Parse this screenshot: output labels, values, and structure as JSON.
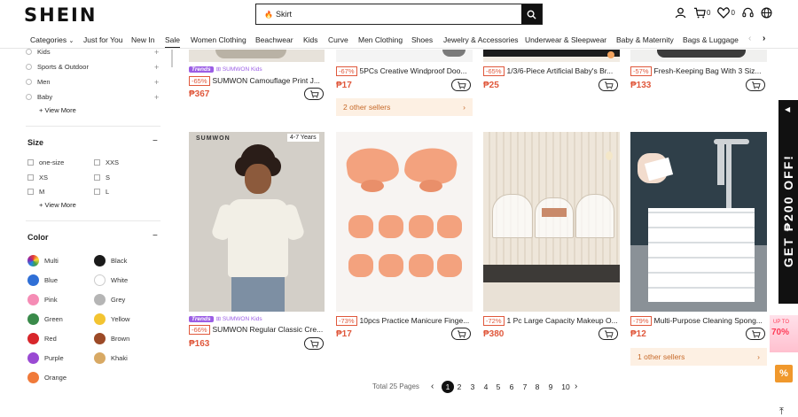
{
  "header": {
    "logo": "SHEIN",
    "search_value": "Skirt",
    "cart_count": "0",
    "wishlist_count": "0"
  },
  "nav": {
    "categories": [
      "Categories",
      "Just for You",
      "New In",
      "Sale",
      "Women Clothing",
      "Beachwear",
      "Kids",
      "Curve",
      "Men Clothing",
      "Shoes",
      "Jewelry & Accessories",
      "Underwear & Sleepwear",
      "Baby & Maternity",
      "Bags & Luggage"
    ]
  },
  "sidebar": {
    "categories": [
      "Kids",
      "Sports & Outdoor",
      "Men",
      "Baby"
    ],
    "view_more": "View More",
    "size_title": "Size",
    "sizes": [
      "one-size",
      "XXS",
      "XS",
      "S",
      "M",
      "L"
    ],
    "color_title": "Color",
    "colors": [
      {
        "label": "Multi",
        "hex": "multi"
      },
      {
        "label": "Black",
        "hex": "#1a1a1a"
      },
      {
        "label": "Blue",
        "hex": "#2f6fd6"
      },
      {
        "label": "White",
        "hex": "#ffffff"
      },
      {
        "label": "Pink",
        "hex": "#f58cb5"
      },
      {
        "label": "Grey",
        "hex": "#b5b5b5"
      },
      {
        "label": "Green",
        "hex": "#3a8a4a"
      },
      {
        "label": "Yellow",
        "hex": "#f3c431"
      },
      {
        "label": "Red",
        "hex": "#d8262b"
      },
      {
        "label": "Brown",
        "hex": "#9c4a27"
      },
      {
        "label": "Purple",
        "hex": "#9a4ad3"
      },
      {
        "label": "Khaki",
        "hex": "#d8a964"
      },
      {
        "label": "Orange",
        "hex": "#f07a3a"
      }
    ]
  },
  "products_top": [
    {
      "trend": "Trends",
      "brand": "SUMWON Kids",
      "discount": "-65%",
      "title": "SUMWON Camouflage Print J...",
      "price": "₱367"
    },
    {
      "discount": "-67%",
      "title": "5PCs Creative Windproof Doo...",
      "price": "₱17",
      "sellers": "2 other sellers"
    },
    {
      "discount": "-65%",
      "title": "1/3/6-Piece Artificial Baby's Br...",
      "price": "₱25"
    },
    {
      "discount": "-57%",
      "title": "Fresh-Keeping Bag With 3 Siz...",
      "price": "₱133"
    }
  ],
  "products_bottom": [
    {
      "trend": "Trends",
      "brand": "SUMWON Kids",
      "discount": "-66%",
      "title": "SUMWON Regular Classic Cre...",
      "price": "₱163",
      "age": "4-7 Years",
      "img_brand": "SUMWON"
    },
    {
      "discount": "-73%",
      "title": "10pcs Practice Manicure Finge...",
      "price": "₱17"
    },
    {
      "discount": "-72%",
      "title": "1 Pc Large Capacity Makeup O...",
      "price": "₱380"
    },
    {
      "discount": "-79%",
      "title": "Multi-Purpose Cleaning Spong...",
      "price": "₱12",
      "sellers": "1 other sellers"
    }
  ],
  "pagination": {
    "total": "Total 25 Pages",
    "pages": [
      "1",
      "2",
      "3",
      "4",
      "5",
      "6",
      "7",
      "8",
      "9",
      "10"
    ],
    "current": "1"
  },
  "promo": {
    "text": "GET ₱200 OFF!",
    "float_text": "70%",
    "float_up": "UP TO"
  }
}
